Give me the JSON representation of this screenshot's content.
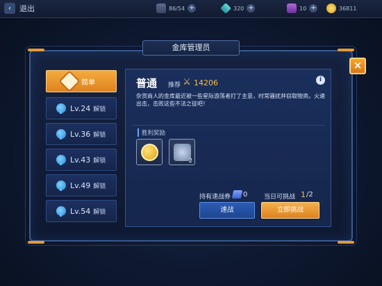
{
  "topbar": {
    "back_label": "退出",
    "resources": [
      {
        "icon": "energy-icon",
        "value": "86/54"
      },
      {
        "icon": "diamond-icon",
        "value": "320"
      },
      {
        "icon": "crystal-icon",
        "value": "10"
      },
      {
        "icon": "gold-coin-icon",
        "value": "36811"
      }
    ]
  },
  "dialog": {
    "title": "金库管理员",
    "close_label": "×"
  },
  "tabs": [
    {
      "lv": "",
      "label": "简单",
      "active": true
    },
    {
      "lv": "Lv.24",
      "label": "解锁",
      "active": false
    },
    {
      "lv": "Lv.36",
      "label": "解锁",
      "active": false
    },
    {
      "lv": "Lv.43",
      "label": "解锁",
      "active": false
    },
    {
      "lv": "Lv.49",
      "label": "解锁",
      "active": false
    },
    {
      "lv": "Lv.54",
      "label": "解锁",
      "active": false
    }
  ],
  "level": {
    "name": "普通",
    "recommend_label": "推荐",
    "recommend_value": "14206",
    "description": "杂货商人的金库最近被一些星际游荡者打了主意，时常骚扰并窃取物资。火速出击，击败这些不法之徒吧！"
  },
  "rewards": {
    "title": "胜利奖励",
    "items": [
      {
        "icon": "gold-coin-icon",
        "count": ""
      },
      {
        "icon": "equipment-box-icon",
        "count": "2"
      }
    ]
  },
  "footer": {
    "ticket_label": "持有速战券",
    "ticket_count": "0",
    "challenge_label": "当日可挑战",
    "challenge_used": "1",
    "challenge_total": "/2",
    "sweep_button": "速战",
    "challenge_button": "立即挑战"
  },
  "colors": {
    "accent_orange": "#f09a2c",
    "panel_blue": "#1a2f5c",
    "gold_text": "#f5c24a"
  }
}
